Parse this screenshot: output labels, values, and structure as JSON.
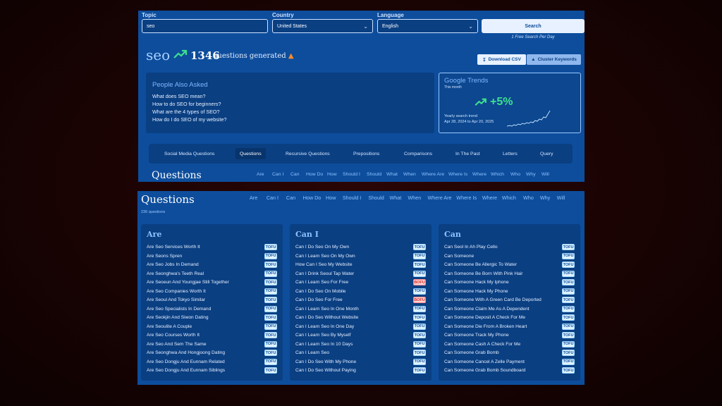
{
  "search": {
    "topic_label": "Topic",
    "topic_value": "seo",
    "country_label": "Country",
    "country_value": "United States",
    "language_label": "Language",
    "language_value": "English",
    "search_button": "Search",
    "free_note": "1 Free Search Per Day"
  },
  "summary": {
    "topic": "seo",
    "count": "1346",
    "generated_text": "questions generated",
    "download_csv": "Download CSV",
    "cluster_keywords": "Cluster Keywords"
  },
  "people_also_ask": {
    "title": "People Also Asked",
    "items": [
      "What does SEO mean?",
      "How to do SEO for beginners?",
      "What are the 4 types of SEO?",
      "How do I do SEO of my website?"
    ]
  },
  "google_trends": {
    "title": "Google Trends",
    "subtitle": "This month",
    "change": "+5%",
    "yearly_label": "Yearly search trend",
    "range": "Apr 28, 2024 to Apr 20, 2025"
  },
  "categories": {
    "tabs": [
      "Social Media Questions",
      "Questions",
      "Recursive Questions",
      "Prepositions",
      "Comparisons",
      "In The Past",
      "Letters",
      "Query"
    ],
    "active": "Questions"
  },
  "questions_section": {
    "title": "Questions",
    "count_label": "236 questions",
    "filters": [
      "Are",
      "Can I",
      "Can",
      "How Do",
      "How",
      "Should I",
      "Should",
      "What",
      "When",
      "Where Are",
      "Where Is",
      "Where",
      "Which",
      "Who",
      "Why",
      "Will"
    ]
  },
  "columns": [
    {
      "title": "Are",
      "rows": [
        {
          "text": "Are Seo Services Worth It",
          "tag": "TOFU"
        },
        {
          "text": "Are Seons Spren",
          "tag": "TOFU"
        },
        {
          "text": "Are Seo Jobs In Demand",
          "tag": "TOFU"
        },
        {
          "text": "Are Seonghwa's Teeth Real",
          "tag": "TOFU"
        },
        {
          "text": "Are Seoeun And Youngjae Still Together",
          "tag": "TOFU"
        },
        {
          "text": "Are Seo Companies Worth It",
          "tag": "TOFU"
        },
        {
          "text": "Are Seoul And Tokyo Similar",
          "tag": "TOFU"
        },
        {
          "text": "Are Seo Specialists In Demand",
          "tag": "TOFU"
        },
        {
          "text": "Are Seokjin And Siwon Dating",
          "tag": "TOFU"
        },
        {
          "text": "Are Seoulite A Couple",
          "tag": "TOFU"
        },
        {
          "text": "Are Seo Courses Worth It",
          "tag": "TOFU"
        },
        {
          "text": "Are Seo And Sem The Same",
          "tag": "TOFU"
        },
        {
          "text": "Are Seonghwa And Hongjoong Dating",
          "tag": "TOFU"
        },
        {
          "text": "Are Seo Dongju And Eunnam Related",
          "tag": "TOFU"
        },
        {
          "text": "Are Seo Dongju And Eunnam Siblings",
          "tag": "TOFU"
        }
      ]
    },
    {
      "title": "Can I",
      "rows": [
        {
          "text": "Can I Do Seo On My Own",
          "tag": "TOFU"
        },
        {
          "text": "Can I Learn Seo On My Own",
          "tag": "TOFU"
        },
        {
          "text": "How Can I Seo My Website",
          "tag": "TOFU"
        },
        {
          "text": "Can I Drink Seoul Tap Water",
          "tag": "TOFU"
        },
        {
          "text": "Can I Learn Seo For Free",
          "tag": "BOFU"
        },
        {
          "text": "Can I Do Seo On Mobile",
          "tag": "TOFU"
        },
        {
          "text": "Can I Do Seo For Free",
          "tag": "BOFU"
        },
        {
          "text": "Can I Learn Seo In One Month",
          "tag": "TOFU"
        },
        {
          "text": "Can I Do Seo Without Website",
          "tag": "TOFU"
        },
        {
          "text": "Can I Learn Seo In One Day",
          "tag": "TOFU"
        },
        {
          "text": "Can I Learn Seo By Myself",
          "tag": "TOFU"
        },
        {
          "text": "Can I Learn Seo In 10 Days",
          "tag": "TOFU"
        },
        {
          "text": "Can I Learn Seo",
          "tag": "TOFU"
        },
        {
          "text": "Can I Do Seo With My Phone",
          "tag": "TOFU"
        },
        {
          "text": "Can I Do Seo Without Paying",
          "tag": "TOFU"
        }
      ]
    },
    {
      "title": "Can",
      "rows": [
        {
          "text": "Can Seol In Ah Play Cello",
          "tag": "TOFU"
        },
        {
          "text": "Can Someone",
          "tag": "TOFU"
        },
        {
          "text": "Can Someone Be Allergic To Water",
          "tag": "TOFU"
        },
        {
          "text": "Can Someone Be Born With Pink Hair",
          "tag": "TOFU"
        },
        {
          "text": "Can Someone Hack My Iphone",
          "tag": "TOFU"
        },
        {
          "text": "Can Someone Hack My Phone",
          "tag": "TOFU"
        },
        {
          "text": "Can Someone With A Green Card Be Deported",
          "tag": "TOFU"
        },
        {
          "text": "Can Someone Claim Me As A Dependent",
          "tag": "TOFU"
        },
        {
          "text": "Can Someone Deposit A Check For Me",
          "tag": "TOFU"
        },
        {
          "text": "Can Someone Die From A Broken Heart",
          "tag": "TOFU"
        },
        {
          "text": "Can Someone Track My Phone",
          "tag": "TOFU"
        },
        {
          "text": "Can Someone Cash A Check For Me",
          "tag": "TOFU"
        },
        {
          "text": "Can Someone Grab Bomb",
          "tag": "TOFU"
        },
        {
          "text": "Can Someone Cancel A Zelle Payment",
          "tag": "TOFU"
        },
        {
          "text": "Can Someone Grab Bomb Soundboard",
          "tag": "TOFU"
        }
      ]
    }
  ],
  "colors": {
    "panel": "#0d4d9c",
    "card": "#0a3f82",
    "accent_green": "#3de08f",
    "tofu": "#dff3ff",
    "bofu": "#ffd6d6"
  }
}
